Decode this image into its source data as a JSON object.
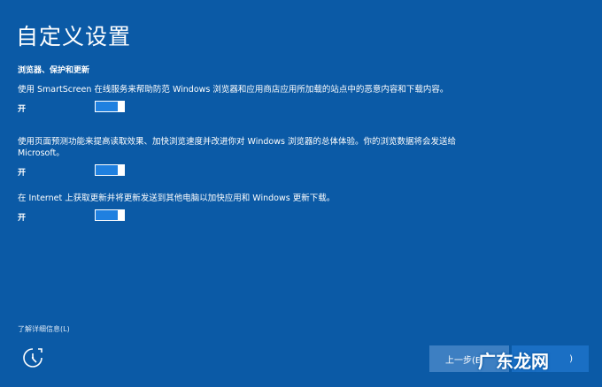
{
  "header": {
    "title": "自定义设置"
  },
  "section": {
    "heading": "浏览器、保护和更新"
  },
  "settings": [
    {
      "description": "使用 SmartScreen 在线服务来帮助防范 Windows 浏览器和应用商店应用所加载的站点中的恶意内容和下载内容。",
      "toggle_label": "开",
      "state": "on"
    },
    {
      "description": "使用页面预测功能来提高读取效果、加快浏览速度并改进你对 Windows 浏览器的总体体验。你的浏览数据将会发送给 Microsoft。",
      "toggle_label": "开",
      "state": "on"
    },
    {
      "description": "在 Internet 上获取更新并将更新发送到其他电脑以加快应用和 Windows 更新下载。",
      "toggle_label": "开",
      "state": "on"
    }
  ],
  "footer": {
    "learn_more": "了解详细信息(L)",
    "back_label": "上一步(B",
    "next_label": ")",
    "watermark": "广东龙网"
  },
  "colors": {
    "background": "#0b5aa6",
    "toggle_fill": "#1f80e0",
    "back_button": "#3d7fc2"
  },
  "icons": {
    "accessibility": "ease-of-access-icon"
  }
}
